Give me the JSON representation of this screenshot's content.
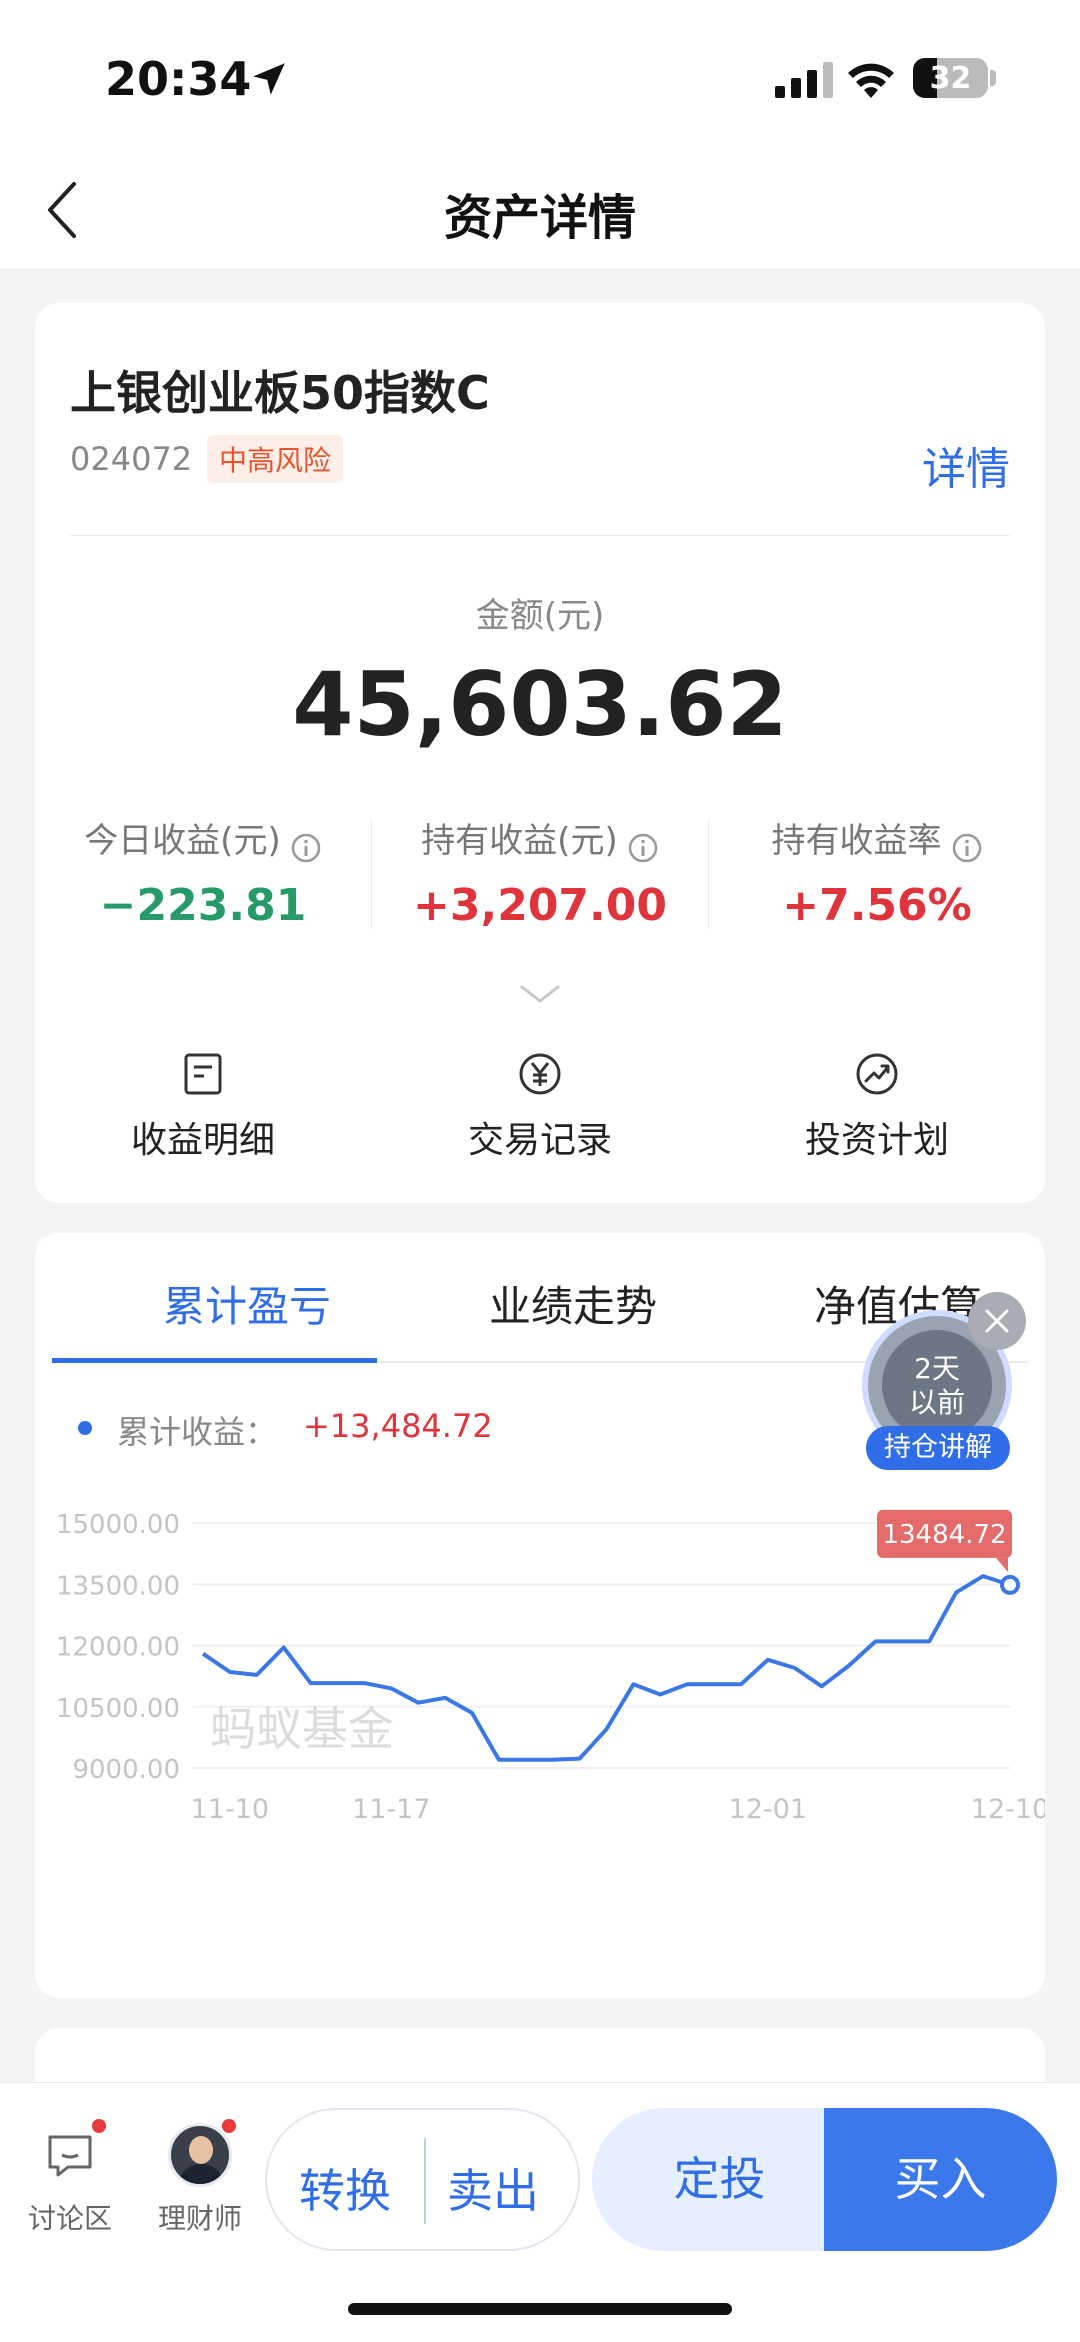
{
  "status_bar": {
    "time": "20:34",
    "battery": "32",
    "battery_level": 0.32
  },
  "nav": {
    "title": "资产详情"
  },
  "fund": {
    "name": "上银创业板50指数C",
    "code": "024072",
    "risk": "中高风险",
    "detail_link": "详情",
    "amount_label": "金额(元)",
    "amount": "45,603.62",
    "stats": [
      {
        "label": "今日收益(元)",
        "value": "−223.81"
      },
      {
        "label": "持有收益(元)",
        "value": "+3,207.00"
      },
      {
        "label": "持有收益率",
        "value": "+7.56%"
      }
    ],
    "actions": [
      {
        "label": "收益明细",
        "icon": "document-icon"
      },
      {
        "label": "交易记录",
        "icon": "yen-icon"
      },
      {
        "label": "投资计划",
        "icon": "growth-icon"
      }
    ]
  },
  "tabs": [
    "累计盈亏",
    "业绩走势",
    "净值估算"
  ],
  "legend": {
    "label": "累计收益：",
    "value": "+13,484.72"
  },
  "floating_widget": {
    "text_line1": "2天",
    "text_line2": "以前",
    "badge": "持仓讲解"
  },
  "chart_data": {
    "type": "line",
    "y_ticks": [
      "15000.00",
      "13500.00",
      "12000.00",
      "10500.00",
      "9000.00"
    ],
    "ylim": [
      9000,
      15000
    ],
    "x_tick_labels": [
      {
        "label": "11-10",
        "index": 1
      },
      {
        "label": "11-17",
        "index": 7
      },
      {
        "label": "12-01",
        "index": 21
      },
      {
        "label": "12-10",
        "index": 30
      }
    ],
    "series": [
      {
        "values": [
          11800,
          11350,
          11280,
          11950,
          11080,
          11080,
          11080,
          10950,
          10600,
          10720,
          10350,
          9200,
          9200,
          9200,
          9230,
          9950,
          11050,
          10800,
          11050,
          11050,
          11050,
          11650,
          11450,
          11000,
          11500,
          12100,
          12100,
          12100,
          13300,
          13700,
          13484.72
        ]
      }
    ],
    "last_point_label": "13484.72",
    "watermark": "蚂蚁基金",
    "line_color": "#3b78e7"
  },
  "bottom_bar": {
    "discuss": "讨论区",
    "advisor": "理财师",
    "convert": "转换",
    "sell": "卖出",
    "auto_invest": "定投",
    "buy": "买入"
  }
}
